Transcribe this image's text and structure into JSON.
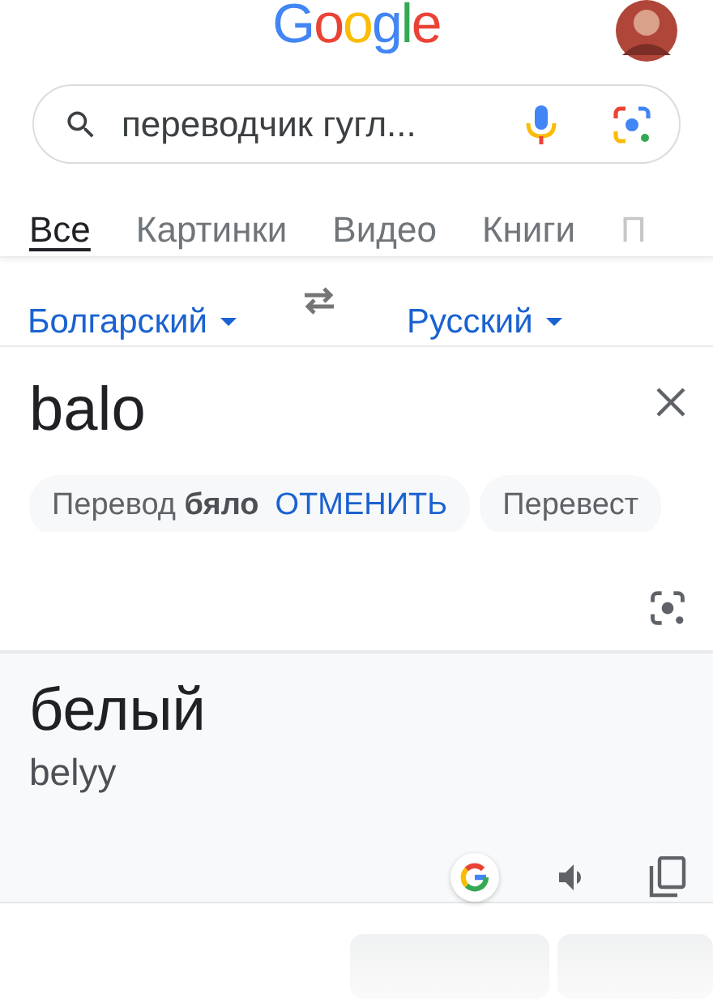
{
  "logo": "Google",
  "search": {
    "value": "переводчик гугл..."
  },
  "tabs": [
    {
      "label": "Все",
      "selected": true
    },
    {
      "label": "Картинки",
      "selected": false
    },
    {
      "label": "Видео",
      "selected": false
    },
    {
      "label": "Книги",
      "selected": false
    },
    {
      "label": "П",
      "selected": false
    }
  ],
  "translator": {
    "source_language": "Болгарский",
    "target_language": "Русский",
    "input": "balo",
    "chips": [
      {
        "text": "Перевод **бяло**",
        "action": "ОТМЕНИТЬ"
      },
      {
        "text": "Перевест"
      }
    ],
    "output": "белый",
    "transliteration": "belyy"
  }
}
